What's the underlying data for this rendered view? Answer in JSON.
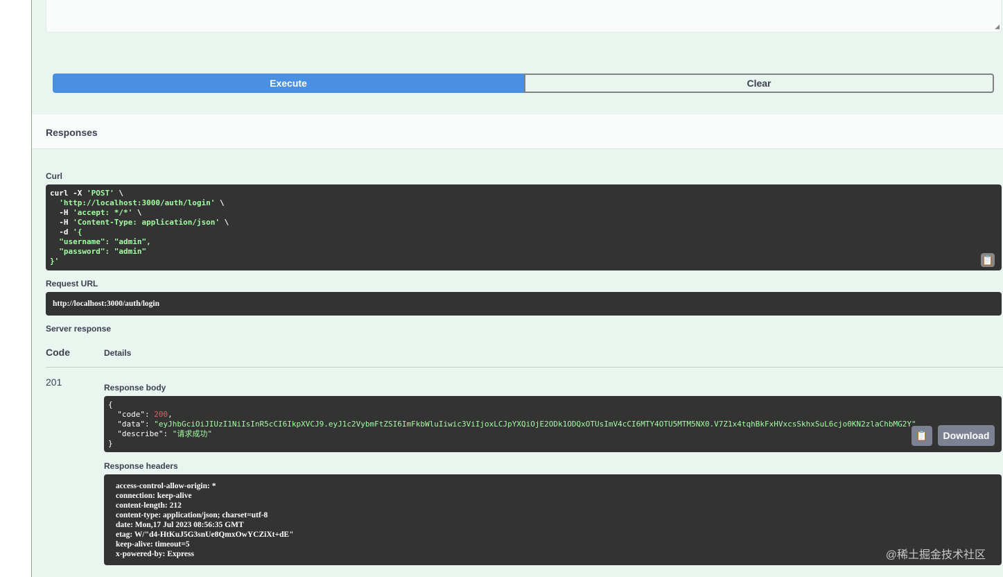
{
  "buttons": {
    "execute": "Execute",
    "clear": "Clear",
    "download": "Download"
  },
  "responses_title": "Responses",
  "curl": {
    "label": "Curl",
    "lines": [
      "curl -X ",
      "'POST'",
      " \\",
      "  'http://localhost:3000/auth/login'",
      " \\",
      "  -H ",
      "'accept: */*'",
      " \\",
      "  -H ",
      "'Content-Type: application/json'",
      " \\",
      "  -d ",
      "'{",
      "  \"username\": \"admin\",",
      "  \"password\": \"admin\"",
      "}'"
    ]
  },
  "request_url": {
    "label": "Request URL",
    "value": "http://localhost:3000/auth/login"
  },
  "server_response": {
    "label": "Server response",
    "code_header": "Code",
    "details_header": "Details",
    "code": "201"
  },
  "response_body": {
    "label": "Response body",
    "code": "200",
    "data": "\"eyJhbGciOiJIUzI1NiIsInR5cCI6IkpXVCJ9.eyJ1c2VybmFtZSI6ImFkbWluIiwic3ViIjoxLCJpYXQiOjE2ODk1ODQxOTUsImV4cCI6MTY4OTU5MTM5NX0.V7Z1x4tqhBkFxHVxcsSkhxSuL6cjo0KN2zlaChbMG2Y\"",
    "describe": "\"请求成功\""
  },
  "response_headers": {
    "label": "Response headers",
    "lines": [
      "access-control-allow-origin: *",
      "connection: keep-alive",
      "content-length: 212",
      "content-type: application/json; charset=utf-8",
      "date: Mon,17 Jul 2023 08:56:35 GMT",
      "etag: W/\"d4-HtKuJ5G3snUe8QmxOwYCZiXt+dE\"",
      "keep-alive: timeout=5",
      "x-powered-by: Express"
    ]
  },
  "watermark": "@稀土掘金技术社区"
}
